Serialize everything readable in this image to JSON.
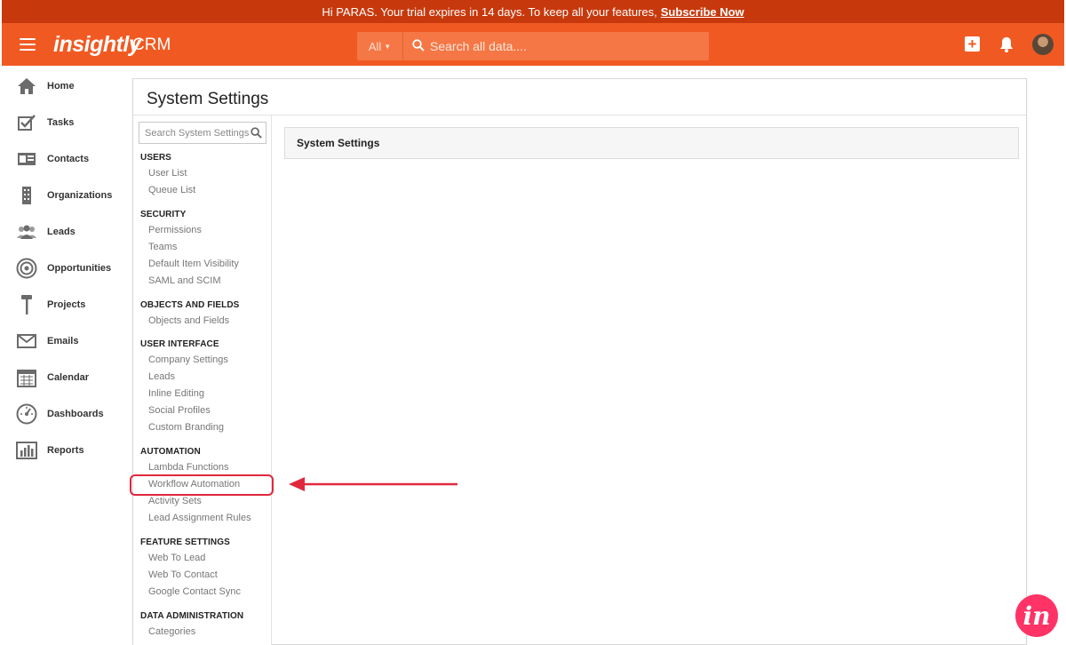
{
  "banner": {
    "message": "Hi PARAS. Your trial expires in 14 days. To keep all your features,",
    "link": "Subscribe Now"
  },
  "header": {
    "logo": "insightly",
    "product": "CRM",
    "search_scope": "All",
    "search_placeholder": "Search all data....",
    "icons": [
      "menu-icon",
      "plus-icon",
      "bell-icon",
      "avatar"
    ]
  },
  "nav": [
    {
      "label": "Home",
      "icon": "home-icon"
    },
    {
      "label": "Tasks",
      "icon": "tasks-icon"
    },
    {
      "label": "Contacts",
      "icon": "contacts-icon"
    },
    {
      "label": "Organizations",
      "icon": "organizations-icon"
    },
    {
      "label": "Leads",
      "icon": "leads-icon"
    },
    {
      "label": "Opportunities",
      "icon": "opportunities-icon"
    },
    {
      "label": "Projects",
      "icon": "projects-icon"
    },
    {
      "label": "Emails",
      "icon": "emails-icon"
    },
    {
      "label": "Calendar",
      "icon": "calendar-icon"
    },
    {
      "label": "Dashboards",
      "icon": "dashboards-icon"
    },
    {
      "label": "Reports",
      "icon": "reports-icon"
    }
  ],
  "page": {
    "title": "System Settings",
    "settings_search_placeholder": "Search System Settings",
    "content_title": "System Settings"
  },
  "settings_nav": [
    {
      "title": "USERS",
      "items": [
        "User List",
        "Queue List"
      ]
    },
    {
      "title": "SECURITY",
      "items": [
        "Permissions",
        "Teams",
        "Default Item Visibility",
        "SAML and SCIM"
      ]
    },
    {
      "title": "OBJECTS AND FIELDS",
      "items": [
        "Objects and Fields"
      ]
    },
    {
      "title": "USER INTERFACE",
      "items": [
        "Company Settings",
        "Leads",
        "Inline Editing",
        "Social Profiles",
        "Custom Branding"
      ]
    },
    {
      "title": "AUTOMATION",
      "items": [
        "Lambda Functions",
        "Workflow Automation",
        "Activity Sets",
        "Lead Assignment Rules"
      ]
    },
    {
      "title": "FEATURE SETTINGS",
      "items": [
        "Web To Lead",
        "Web To Contact",
        "Google Contact Sync"
      ]
    },
    {
      "title": "DATA ADMINISTRATION",
      "items": [
        "Categories"
      ]
    }
  ],
  "highlighted_item": "Workflow Automation",
  "colors": {
    "brand": "#f05a22",
    "banner": "#c7390d",
    "highlight": "#e0283d",
    "invision": "#ff3366"
  },
  "badge": "in"
}
